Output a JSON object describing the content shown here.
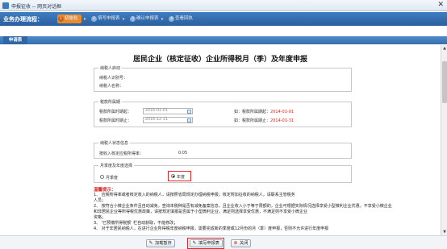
{
  "window": {
    "title": "申报征收 -- 网页对话框",
    "close_glyph": "✕"
  },
  "progress": {
    "label": "业务办理流程：",
    "steps": [
      {
        "num": "1",
        "label": "初始化"
      },
      {
        "num": "2",
        "label": "填写申报表"
      },
      {
        "num": "3",
        "label": "确认申报表"
      },
      {
        "num": "4",
        "label": "查看回执"
      }
    ],
    "arrow_glyph": "▸"
  },
  "section_tab": "申请表",
  "form": {
    "title": "居民企业（核定征收）企业所得税月（季）及年度申报",
    "taxpayer": {
      "legend": "纳税人启动",
      "id_label": "纳税人识别号：",
      "name_label": "纳税人名称："
    },
    "period": {
      "legend": "税款所属期",
      "start_label": "税款所属时期起：",
      "start_value": "2016-01-01",
      "end_label": "税款所属时期止：",
      "end_value": "2016-12-31",
      "start_example_prefix": "如：税款所属期起：",
      "start_example_value": "2014-01-01",
      "end_example_prefix": "如：税款所属期止：",
      "end_example_value": "2014-01-31"
    },
    "status": {
      "legend": "纳税人状态信息",
      "rate_label": "按收入核定应税所得率：",
      "rate_value": "0.05"
    },
    "report_type": {
      "legend": "月季度及年度选择",
      "option_quarter": "月季度",
      "option_annual": "年度",
      "selected": "年度"
    }
  },
  "tips": {
    "title": "温馨提示：",
    "lines": [
      "1、 应税所得率或者核定收入的纳税人，请按照省局规定办理纳税申报；核定附加征收的纳税人，请联系主管税务",
      "人员；",
      "2、 按符合小微企业条件且自动减免，查询本税种是否有减免备案信息，且企业收入小于等于限额的，企业可根据实际情况选择享受小型微利企业优惠，不享受小微企业",
      "和非居民企业等所得税优惠政策，请按规定填报是否属于小型微利企业，满足则选择享受优惠，不满足则不享受小微企业",
      "资格；",
      "3、 '已预缴所得税额' 栏自动获取，不能修改；",
      "4、 对于非居民纳税人，在进行企业所得税年度纳税申报，需要完成新的季度或12月份的月（季）度申报，否则不允许进行年度申报"
    ]
  },
  "footer": {
    "save_label": "加载暂存",
    "fill_label": "填写申报表",
    "close_label": "关闭",
    "save_icon": "✎",
    "fill_icon": "✎",
    "close_icon": "⊗"
  },
  "colors": {
    "brand_blue": "#2a5f9e",
    "active_step": "#e98a2b",
    "hint_red": "#d8261e",
    "highlight_red": "#e0282a"
  }
}
